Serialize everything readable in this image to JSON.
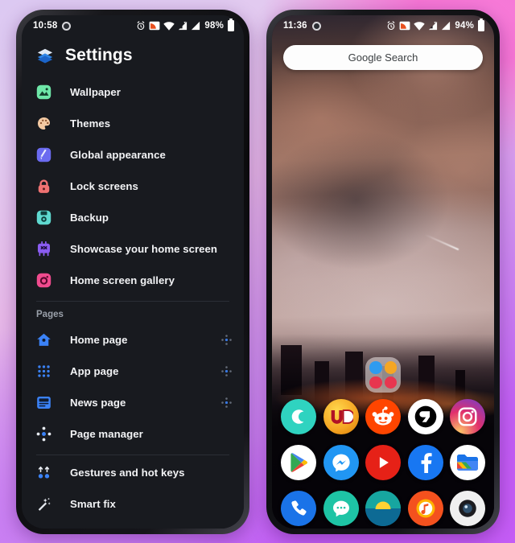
{
  "background": {
    "gradient_from": "#dcc9f2",
    "gradient_to": "#bb55f4"
  },
  "left_phone": {
    "status_bar": {
      "time": "10:58",
      "battery_percent": "98%",
      "icons": [
        "alarm-icon",
        "cast-icon",
        "wifi-icon",
        "signal-icon",
        "signal-icon",
        "battery-icon"
      ]
    },
    "header": {
      "title": "Settings",
      "icon": "layers-icon"
    },
    "items": [
      {
        "label": "Wallpaper",
        "icon": "wallpaper-icon",
        "color": "#6ee7a8"
      },
      {
        "label": "Themes",
        "icon": "palette-icon",
        "color": "#f3c9a2"
      },
      {
        "label": "Global appearance",
        "icon": "brush-icon",
        "color": "#6b6bf0"
      },
      {
        "label": "Lock screens",
        "icon": "lock-icon",
        "color": "#ef7272"
      },
      {
        "label": "Backup",
        "icon": "save-icon",
        "color": "#5fd9d0"
      },
      {
        "label": "Showcase your home screen",
        "icon": "showcase-icon",
        "color": "#8a5cf0"
      },
      {
        "label": "Home screen gallery",
        "icon": "gallery-icon",
        "color": "#f04b8e"
      }
    ],
    "pages_section": {
      "label": "Pages",
      "items": [
        {
          "label": "Home page",
          "icon": "home-icon",
          "color": "#3b82f6",
          "handle": "drag-handle-icon"
        },
        {
          "label": "App page",
          "icon": "apps-grid-icon",
          "color": "#3b82f6",
          "handle": "drag-handle-icon"
        },
        {
          "label": "News page",
          "icon": "news-icon",
          "color": "#3b82f6",
          "handle": "drag-handle-icon"
        },
        {
          "label": "Page manager",
          "icon": "page-manager-icon",
          "color": "#3b82f6",
          "handle": ""
        }
      ]
    },
    "footer_items": [
      {
        "label": "Gestures and hot keys",
        "icon": "gestures-icon",
        "color": "#3b82f6"
      },
      {
        "label": "Smart fix",
        "icon": "magic-wand-icon",
        "color": "#cfd4da"
      }
    ]
  },
  "right_phone": {
    "status_bar": {
      "time": "11:36",
      "battery_percent": "94%",
      "icons": [
        "alarm-icon",
        "cast-icon",
        "wifi-icon",
        "signal-icon",
        "signal-icon",
        "battery-icon"
      ]
    },
    "search": {
      "label": "Google Search",
      "placeholder": "Google Search"
    },
    "folder_widget": {
      "name": "app-folder-widget",
      "tiles": [
        {
          "icon": "chat-icon",
          "color": "#2e9bf0"
        },
        {
          "icon": "calendar-icon",
          "color": "#f5a623"
        },
        {
          "icon": "news-tile-icon",
          "color": "#e8364f"
        },
        {
          "icon": "list-tile-icon",
          "color": "#e8364f"
        }
      ]
    },
    "app_rows": [
      [
        {
          "name": "app-icon-c",
          "label": "C",
          "bg": "#2fd3c0"
        },
        {
          "name": "app-icon-ud",
          "label": "UD",
          "bg": "#f5a623"
        },
        {
          "name": "app-icon-reddit",
          "label": "Reddit",
          "bg": "#ff4500"
        },
        {
          "name": "app-icon-9gag",
          "label": "9GAG",
          "bg": "#ffffff"
        },
        {
          "name": "app-icon-instagram",
          "label": "Instagram",
          "bg": "#c13584"
        }
      ],
      [
        {
          "name": "app-icon-play-store",
          "label": "Play Store",
          "bg": "#ffffff"
        },
        {
          "name": "app-icon-messenger",
          "label": "Messenger",
          "bg": "#2196f3"
        },
        {
          "name": "app-icon-youtube",
          "label": "YouTube",
          "bg": "#e62117"
        },
        {
          "name": "app-icon-facebook",
          "label": "Facebook",
          "bg": "#1877f2"
        },
        {
          "name": "app-icon-files",
          "label": "Files",
          "bg": "#ffffff"
        }
      ],
      [
        {
          "name": "app-icon-phone",
          "label": "Phone",
          "bg": "#1a73e8"
        },
        {
          "name": "app-icon-messages",
          "label": "Messages",
          "bg": "#1ec4a5"
        },
        {
          "name": "app-icon-weather",
          "label": "Weather",
          "bg": "#0b6e8f"
        },
        {
          "name": "app-icon-music",
          "label": "Music",
          "bg": "#f4511e"
        },
        {
          "name": "app-icon-camera",
          "label": "Camera",
          "bg": "#efefef"
        }
      ]
    ]
  }
}
